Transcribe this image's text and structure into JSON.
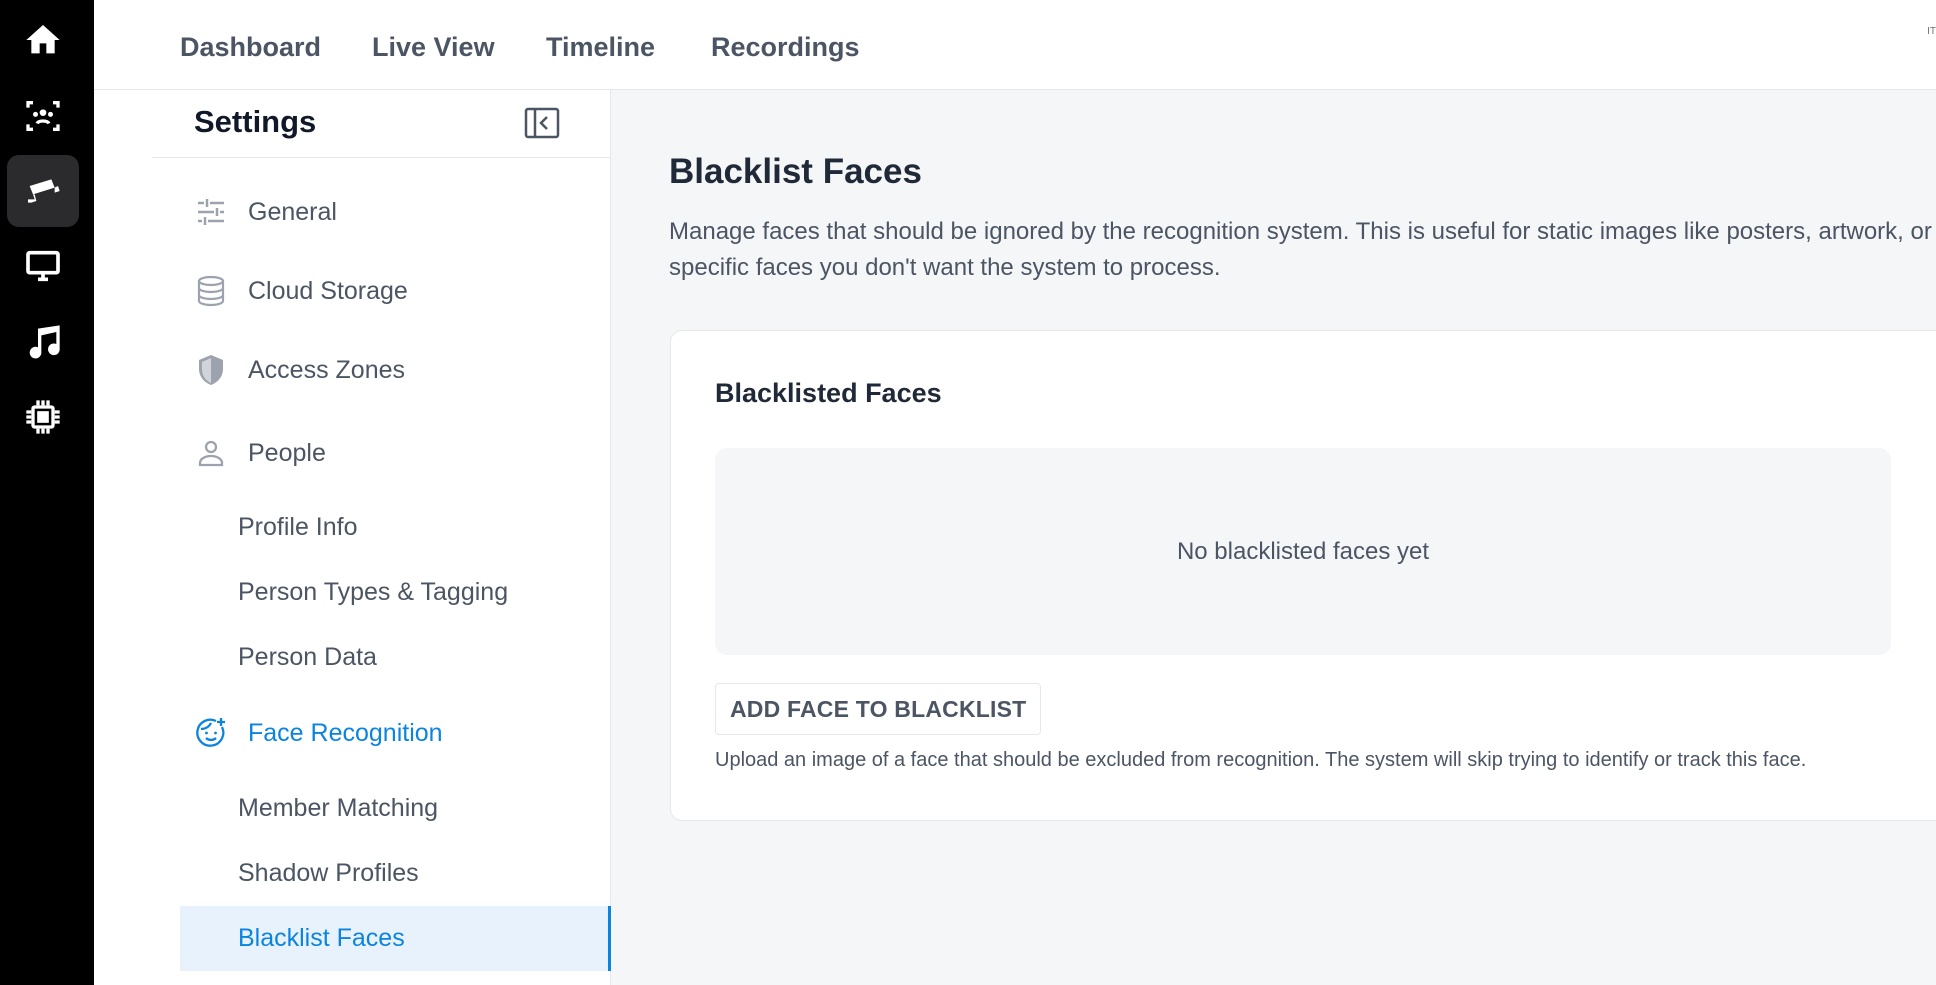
{
  "rail": {
    "items": [
      {
        "icon": "home-icon",
        "active": false
      },
      {
        "icon": "face-scan-icon",
        "active": false
      },
      {
        "icon": "security-camera-icon",
        "active": true
      },
      {
        "icon": "monitor-icon",
        "active": false
      },
      {
        "icon": "music-icon",
        "active": false
      },
      {
        "icon": "chip-icon",
        "active": false
      }
    ]
  },
  "topnav": {
    "tabs": [
      "Dashboard",
      "Live View",
      "Timeline",
      "Recordings"
    ],
    "corner": "IT"
  },
  "sidebar": {
    "title": "Settings",
    "items": [
      {
        "label": "General",
        "icon": "sliders-icon"
      },
      {
        "label": "Cloud Storage",
        "icon": "database-icon"
      },
      {
        "label": "Access Zones",
        "icon": "shield-icon"
      },
      {
        "label": "People",
        "icon": "person-icon"
      },
      {
        "label": "Face Recognition",
        "icon": "face-icon"
      }
    ],
    "people_sub": [
      "Profile Info",
      "Person Types & Tagging",
      "Person Data"
    ],
    "face_sub": [
      "Member Matching",
      "Shadow Profiles",
      "Blacklist Faces"
    ],
    "selected": "Blacklist Faces"
  },
  "main": {
    "title": "Blacklist Faces",
    "description": "Manage faces that should be ignored by the recognition system. This is useful for static images like posters, artwork, or specific faces you don't want the system to process.",
    "card": {
      "title": "Blacklisted Faces",
      "empty_text": "No blacklisted faces yet",
      "add_button": "ADD FACE TO BLACKLIST",
      "help_text": "Upload an image of a face that should be excluded from recognition. The system will skip trying to identify or track this face."
    }
  },
  "colors": {
    "accent": "#0b84e0",
    "rail_bg": "#000000",
    "selected_bg": "#e8f2fd",
    "content_bg": "#f5f6f8"
  }
}
